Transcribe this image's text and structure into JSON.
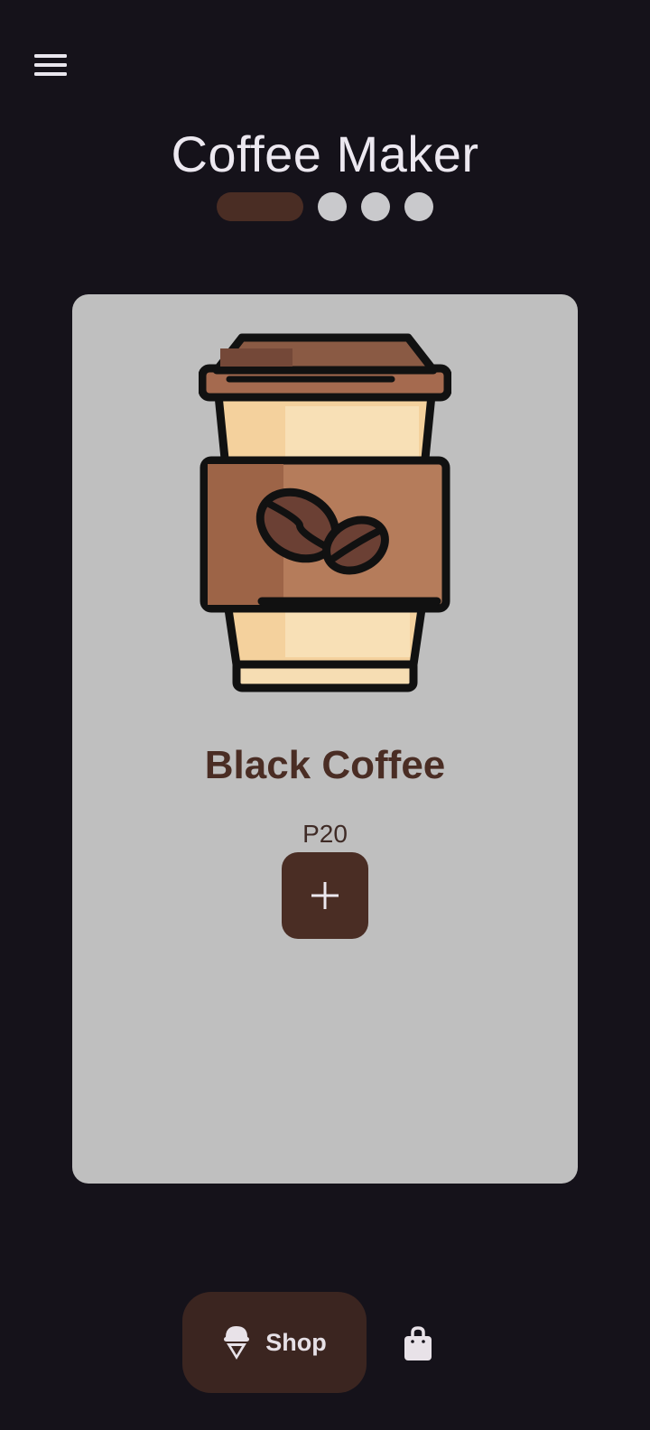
{
  "app": {
    "title": "Coffee Maker"
  },
  "header": {
    "menu_icon": "menu-icon"
  },
  "pager": {
    "count": 4,
    "active_index": 0
  },
  "product": {
    "name": "Black Coffee",
    "price": "P20",
    "image_icon": "coffee-cup-icon",
    "add_icon": "plus-icon"
  },
  "bottom_nav": {
    "items": [
      {
        "label": "Shop",
        "icon": "ice-cream-icon",
        "selected": true
      },
      {
        "label": "",
        "icon": "shopping-bag-icon",
        "selected": false
      }
    ]
  },
  "colors": {
    "background": "#15121a",
    "card": "#bfbfbf",
    "accent_brown": "#4a2d24",
    "nav_selected": "#3b2520",
    "dot_inactive": "#c9c9cc"
  }
}
